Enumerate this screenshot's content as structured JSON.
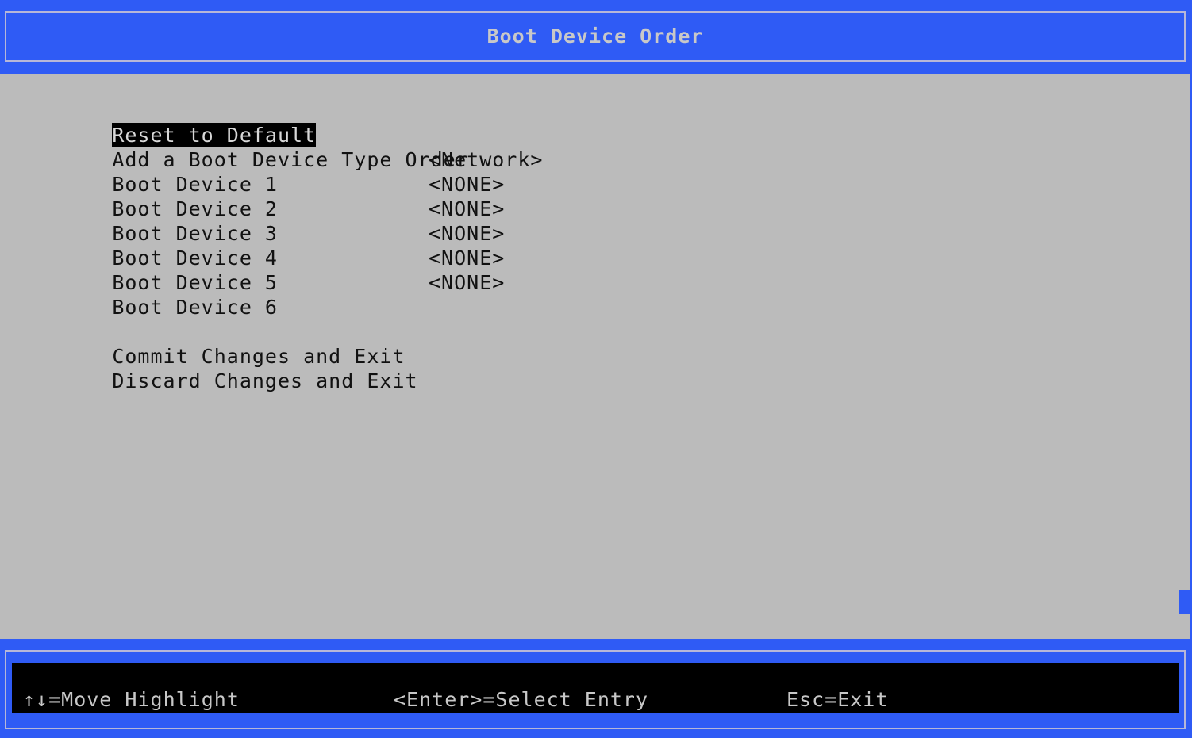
{
  "header": {
    "title": "Boot Device Order"
  },
  "menu": {
    "reset": "Reset to Default",
    "add": "Add a Boot Device Type Order",
    "devices": [
      {
        "label": "Boot Device 1",
        "value": "<Network>"
      },
      {
        "label": "Boot Device 2",
        "value": "<NONE>"
      },
      {
        "label": "Boot Device 3",
        "value": "<NONE>"
      },
      {
        "label": "Boot Device 4",
        "value": "<NONE>"
      },
      {
        "label": "Boot Device 5",
        "value": "<NONE>"
      },
      {
        "label": "Boot Device 6",
        "value": "<NONE>"
      }
    ],
    "commit": "Commit Changes and Exit",
    "discard": "Discard Changes and Exit"
  },
  "footer": {
    "move": "↑↓=Move Highlight",
    "select": "<Enter>=Select Entry",
    "exit": "Esc=Exit"
  },
  "colors": {
    "accent": "#2f5bf5",
    "background": "#bbbbbb",
    "highlight": "#000000"
  }
}
